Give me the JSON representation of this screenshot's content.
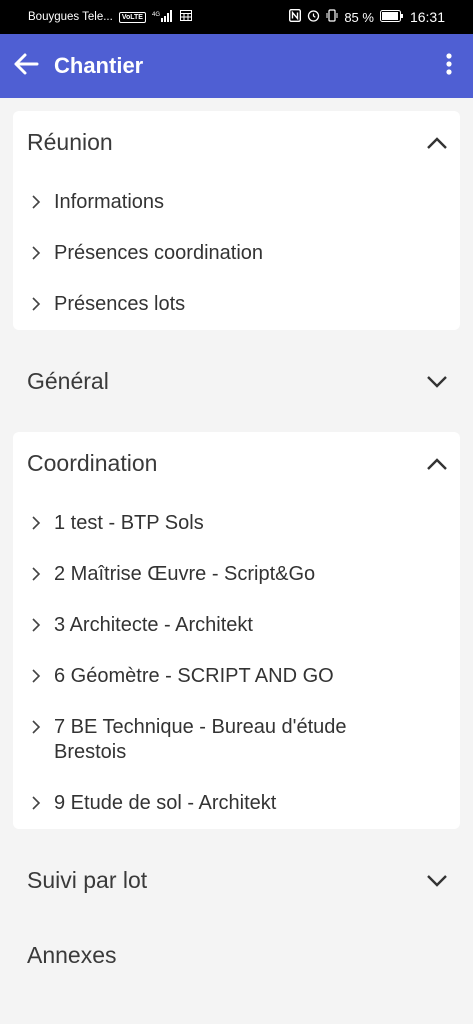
{
  "status_bar": {
    "carrier": "Bouygues Tele...",
    "volte": "VoLTE",
    "network": "4G",
    "battery": "85 %",
    "time": "16:31"
  },
  "app_bar": {
    "title": "Chantier"
  },
  "sections": {
    "reunion": {
      "title": "Réunion",
      "items": [
        "Informations",
        "Présences coordination",
        "Présences lots"
      ]
    },
    "general": {
      "title": "Général"
    },
    "coordination": {
      "title": "Coordination",
      "items": [
        "1 test - BTP Sols",
        "2 Maîtrise Œuvre - Script&Go",
        "3 Architecte - Architekt",
        "6 Géomètre - SCRIPT AND GO",
        "7 BE Technique - Bureau d'étude Brestois",
        "9 Etude de sol - Architekt"
      ]
    },
    "suivi": {
      "title": "Suivi par lot"
    },
    "annexes": {
      "title": "Annexes"
    }
  }
}
